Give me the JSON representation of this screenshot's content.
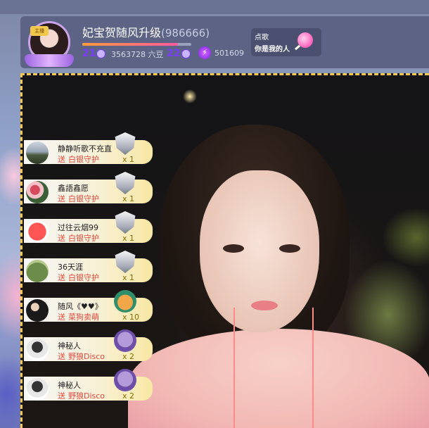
{
  "header": {
    "anchor_name": "妃宝贺随风升级",
    "anchor_id": "(986666)",
    "level_badge": "主播",
    "anchor_level": "21",
    "next_level": "22",
    "beans": "3563728 六豆",
    "fans_count": "501609",
    "progress_fraction": 0.88
  },
  "song_request": {
    "title": "点歌",
    "song": "你是我的人"
  },
  "gift_feed": [
    {
      "user": "静静听歌不充直",
      "prefix": "送",
      "gift": "白银守护",
      "count": "x 1",
      "avatar": "av-mountain",
      "icon": "shield"
    },
    {
      "user": "鑫語鑫愿",
      "prefix": "送",
      "gift": "白银守护",
      "count": "x 1",
      "avatar": "av-flowers",
      "icon": "shield"
    },
    {
      "user": "过往云烟99",
      "prefix": "送",
      "gift": "白银守护",
      "count": "x 1",
      "avatar": "av-red",
      "icon": "shield"
    },
    {
      "user": "36天涯",
      "prefix": "送",
      "gift": "白银守护",
      "count": "x 1",
      "avatar": "av-field",
      "icon": "shield"
    },
    {
      "user": "随风《♥♥》",
      "prefix": "送",
      "gift": "菜狗卖萌",
      "count": "x 10",
      "avatar": "av-dark",
      "icon": "dog"
    },
    {
      "user": "神秘人",
      "prefix": "送",
      "gift": "野狼Disco",
      "count": "x 2",
      "avatar": "av-mystery",
      "icon": "wolf"
    },
    {
      "user": "神秘人",
      "prefix": "送",
      "gift": "野狼Disco",
      "count": "x 2",
      "avatar": "av-mystery",
      "icon": "wolf"
    }
  ]
}
